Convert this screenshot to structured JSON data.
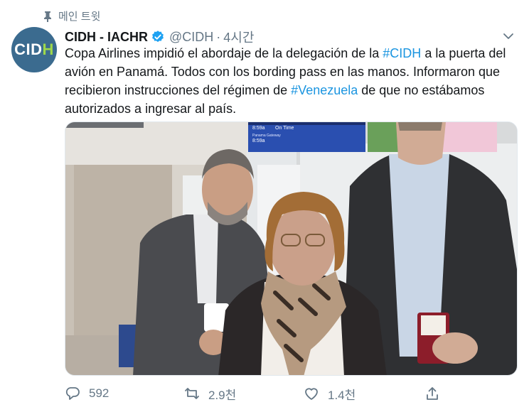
{
  "pinned": {
    "label": "메인 트윗"
  },
  "avatar": {
    "text_main": "CIDH",
    "text_accent": ""
  },
  "tweet": {
    "name": "CIDH - IACHR",
    "handle": "@CIDH",
    "separator": "·",
    "time": "4시간",
    "text_1": "Copa Airlines impidió el abordaje de la delegación de la ",
    "hashtag_1": "#CIDH",
    "text_2": " a la puerta del avión en Panamá. Todos con los bording pass en las manos. Informaron que recibieron instrucciones del régimen de ",
    "hashtag_2": "#Venezuela",
    "text_3": " de que no estábamos autorizados a ingresar al país."
  },
  "photo": {
    "screen_line_1": "8:59a",
    "screen_line_2": "On Time",
    "screen_line_3": "Panama Gateway",
    "screen_line_4": "8:59a"
  },
  "actions": {
    "replies": "592",
    "retweets": "2.9천",
    "likes": "1.4천"
  },
  "colors": {
    "accent": "#1b95e0",
    "muted": "#657786",
    "avatar_bg": "#3b6b8f",
    "avatar_accent": "#9ed84b"
  }
}
